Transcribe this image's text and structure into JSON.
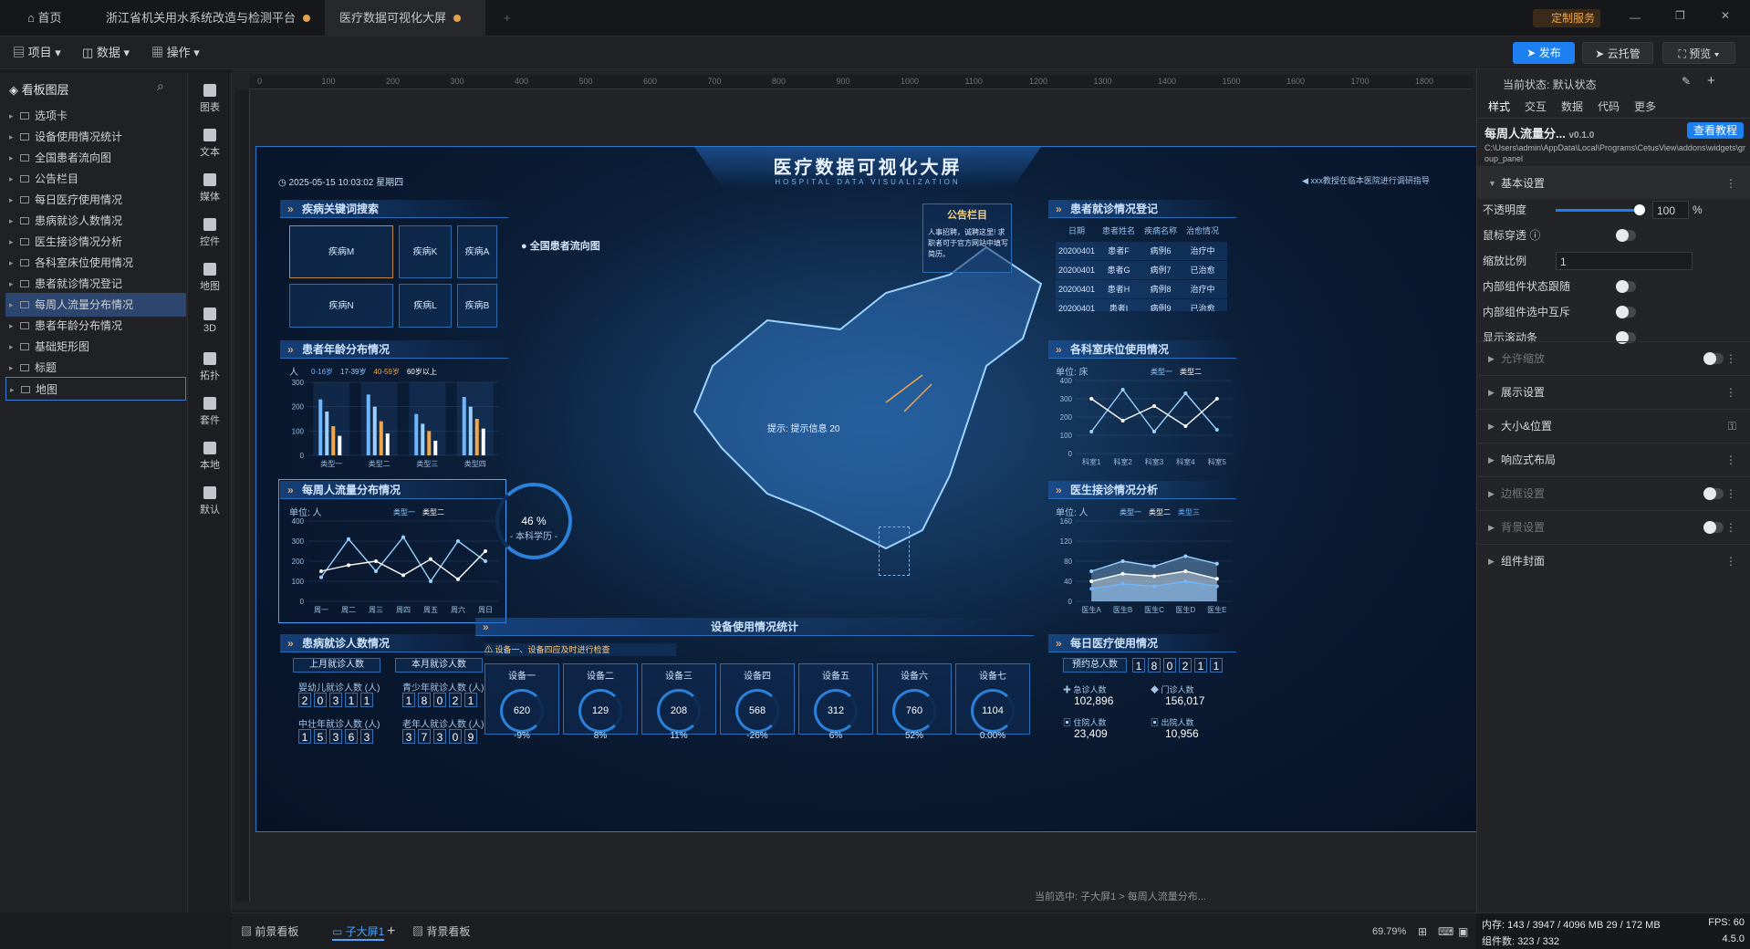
{
  "tabs": {
    "home": "首页",
    "tab1": "浙江省机关用水系统改造与检测平台",
    "tab2": "医疗数据可视化大屏"
  },
  "top_right": {
    "custom_service": "定制服务"
  },
  "toolbar": {
    "project": "项目",
    "data": "数据",
    "operation": "操作",
    "publish": "发布",
    "cloud": "云托管",
    "preview": "预览"
  },
  "layers": {
    "title": "看板图层",
    "items": [
      "选项卡",
      "设备使用情况统计",
      "全国患者流向图",
      "公告栏目",
      "每日医疗使用情况",
      "患病就诊人数情况",
      "医生接诊情况分析",
      "各科室床位使用情况",
      "患者就诊情况登记",
      "每周人流量分布情况",
      "患者年龄分布情况",
      "基础矩形图",
      "标题",
      "地图"
    ]
  },
  "iconbar": [
    "图表",
    "文本",
    "媒体",
    "控件",
    "地图",
    "3D",
    "拓扑",
    "套件",
    "本地",
    "默认"
  ],
  "ruler": [
    "0",
    "100",
    "200",
    "300",
    "400",
    "500",
    "600",
    "700",
    "800",
    "900",
    "1000",
    "1100",
    "1200",
    "1300",
    "1400",
    "1500",
    "1600",
    "1700",
    "1800",
    "1900"
  ],
  "dashboard": {
    "title": "医疗数据可视化大屏",
    "subtitle": "HOSPITAL DATA VISUALIZATION",
    "datetime": "2025-05-15 10:03:02 星期四",
    "notice": "xxx教授在临本医院进行调研指导",
    "disease": {
      "title": "疾病关键词搜索",
      "keys": [
        "疾病M",
        "疾病K",
        "疾病A",
        "疾病N",
        "疾病L",
        "疾病B"
      ]
    },
    "age": {
      "title": "患者年龄分布情况",
      "unit": "人",
      "legend": [
        "0-16岁",
        "17-39岁",
        "40-59岁",
        "60岁以上"
      ],
      "yticks": [
        "300",
        "200",
        "100",
        "0"
      ],
      "cats": [
        "类型一",
        "类型二",
        "类型三",
        "类型四"
      ]
    },
    "weekly": {
      "title": "每周人流量分布情况",
      "unit": "单位: 人",
      "legend": [
        "类型一",
        "类型二"
      ],
      "yticks": [
        "400",
        "300",
        "200",
        "100",
        "0"
      ],
      "days": [
        "周一",
        "周二",
        "周三",
        "周四",
        "周五",
        "周六",
        "周日"
      ]
    },
    "patients": {
      "title": "患病就诊人数情况",
      "last": "上月就诊人数",
      "this": "本月就诊人数",
      "g1": "婴幼儿就诊人数 (人)",
      "v1": "20311",
      "g2": "青少年就诊人数 (人)",
      "v2": "18021",
      "g3": "中壮年就诊人数 (人)",
      "v3": "15363",
      "g4": "老年人就诊人数 (人)",
      "v4": "37309"
    },
    "map": {
      "title": "全国患者流向图",
      "tip": "提示: 提示信息 20",
      "gauge": "46 %",
      "gauge_label": "- 本科学历 -"
    },
    "bulletin": {
      "title": "公告栏目",
      "text": "人事招聘，诚聘这里! 求职者可于官方网站中填写简历。"
    },
    "register": {
      "title": "患者就诊情况登记",
      "head": [
        "日期",
        "患者姓名",
        "疾病名称",
        "治愈情况"
      ],
      "rows": [
        [
          "20200401",
          "患者F",
          "病例6",
          "治疗中"
        ],
        [
          "20200401",
          "患者G",
          "病例7",
          "已治愈"
        ],
        [
          "20200401",
          "患者H",
          "病例8",
          "治疗中"
        ],
        [
          "20200401",
          "患者I",
          "病例9",
          "已治愈"
        ]
      ]
    },
    "beds": {
      "title": "各科室床位使用情况",
      "unit": "单位: 床",
      "legend": [
        "类型一",
        "类型二"
      ],
      "yticks": [
        "400",
        "300",
        "200",
        "100",
        "0"
      ],
      "cats": [
        "科室1",
        "科室2",
        "科室3",
        "科室4",
        "科室5"
      ]
    },
    "doctor": {
      "title": "医生接诊情况分析",
      "unit": "单位: 人",
      "legend": [
        "类型一",
        "类型二",
        "类型三"
      ],
      "yticks": [
        "160",
        "120",
        "80",
        "40",
        "0"
      ],
      "cats": [
        "医生A",
        "医生B",
        "医生C",
        "医生D",
        "医生E"
      ]
    },
    "devices": {
      "title": "设备使用情况统计",
      "alert": "设备一、设备四应及时进行检查",
      "items": [
        {
          "n": "设备一",
          "v": "620",
          "c": "-9%"
        },
        {
          "n": "设备二",
          "v": "129",
          "c": "8%"
        },
        {
          "n": "设备三",
          "v": "208",
          "c": "11%"
        },
        {
          "n": "设备四",
          "v": "568",
          "c": "-26%"
        },
        {
          "n": "设备五",
          "v": "312",
          "c": "6%"
        },
        {
          "n": "设备六",
          "v": "760",
          "c": "52%"
        },
        {
          "n": "设备七",
          "v": "1104",
          "c": "0.00%"
        }
      ]
    },
    "daily": {
      "title": "每日医疗使用情况",
      "booking": "预约总人数",
      "booking_v": "180211",
      "a": "急诊人数",
      "av": "102,896",
      "b": "门诊人数",
      "bv": "156,017",
      "c": "住院人数",
      "cv": "23,409",
      "d": "出院人数",
      "dv": "10,956"
    }
  },
  "canvas_status": "当前选中: 子大屏1 > 每周人流量分布...",
  "props": {
    "state": "当前状态: 默认状态",
    "tabs": [
      "样式",
      "交互",
      "数据",
      "代码",
      "更多"
    ],
    "comp": "每周人流量分...",
    "ver": "v0.1.0",
    "tutorial": "查看教程",
    "path": "C:\\Users\\admin\\AppData\\Local\\Programs\\CetusView\\addons\\widgets\\group_panel",
    "basic": "基本设置",
    "opacity": "不透明度",
    "opacity_v": "100",
    "pct": "%",
    "mouse": "鼠标穿透",
    "scale": "缩放比例",
    "scale_v": "1",
    "follow": "内部组件状态跟随",
    "mutex": "内部组件选中互斥",
    "scroll": "显示滚动条",
    "sections": [
      "允许缩放",
      "展示设置",
      "大小&位置",
      "响应式布局",
      "边框设置",
      "背景设置",
      "组件封面"
    ]
  },
  "bottom": {
    "front": "前景看板",
    "sub": "子大屏1",
    "back": "背景看板",
    "zoom": "69.79%"
  },
  "status": {
    "mem": "内存: 143 / 3947 / 4096 MB  29 / 172 MB",
    "fps": "FPS: 60",
    "count": "组件数: 323 / 332",
    "ver": "4.5.0"
  },
  "colors": {
    "accent": "#1d7ff0",
    "board_border": "#2a78c9",
    "orange": "#f0a64a"
  },
  "chart_data": [
    {
      "type": "bar",
      "title": "患者年龄分布情况",
      "categories": [
        "类型一",
        "类型二",
        "类型三",
        "类型四"
      ],
      "ylim": [
        0,
        300
      ],
      "series": [
        {
          "name": "0-16岁",
          "values": [
            230,
            250,
            170,
            240
          ]
        },
        {
          "name": "17-39岁",
          "values": [
            180,
            200,
            130,
            200
          ]
        },
        {
          "name": "40-59岁",
          "values": [
            120,
            140,
            100,
            150
          ]
        },
        {
          "name": "60岁以上",
          "values": [
            80,
            90,
            60,
            110
          ]
        }
      ]
    },
    {
      "type": "line",
      "title": "每周人流量分布情况",
      "categories": [
        "周一",
        "周二",
        "周三",
        "周四",
        "周五",
        "周六",
        "周日"
      ],
      "ylim": [
        0,
        400
      ],
      "series": [
        {
          "name": "类型一",
          "values": [
            120,
            310,
            150,
            320,
            100,
            300,
            200
          ]
        },
        {
          "name": "类型二",
          "values": [
            150,
            180,
            200,
            130,
            210,
            110,
            250
          ]
        }
      ]
    },
    {
      "type": "line",
      "title": "各科室床位使用情况",
      "categories": [
        "科室1",
        "科室2",
        "科室3",
        "科室4",
        "科室5"
      ],
      "ylim": [
        0,
        400
      ],
      "series": [
        {
          "name": "类型一",
          "values": [
            120,
            350,
            120,
            330,
            130
          ]
        },
        {
          "name": "类型二",
          "values": [
            300,
            180,
            260,
            150,
            300
          ]
        }
      ]
    },
    {
      "type": "area",
      "title": "医生接诊情况分析",
      "categories": [
        "医生A",
        "医生B",
        "医生C",
        "医生D",
        "医生E"
      ],
      "ylim": [
        0,
        160
      ],
      "series": [
        {
          "name": "类型一",
          "values": [
            60,
            80,
            70,
            90,
            75
          ]
        },
        {
          "name": "类型二",
          "values": [
            40,
            55,
            50,
            60,
            45
          ]
        },
        {
          "name": "类型三",
          "values": [
            25,
            35,
            30,
            40,
            30
          ]
        }
      ]
    }
  ]
}
